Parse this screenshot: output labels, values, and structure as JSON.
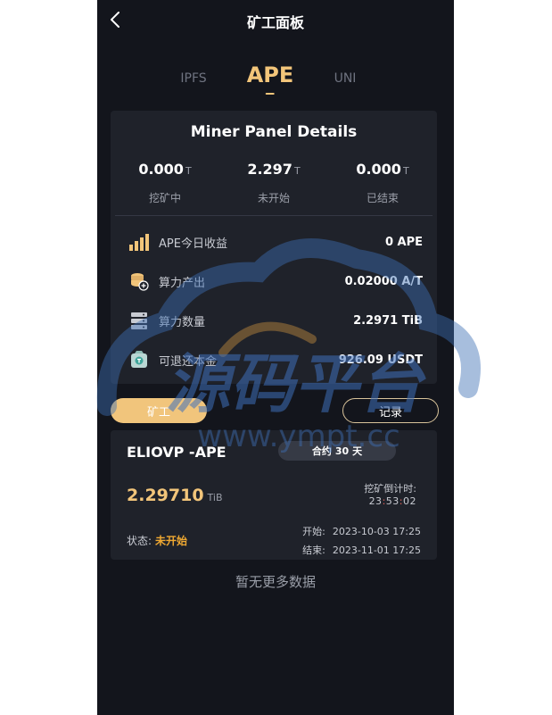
{
  "header": {
    "title": "矿工面板"
  },
  "tabs": [
    {
      "label": "IPFS",
      "active": false
    },
    {
      "label": "APE",
      "active": true
    },
    {
      "label": "UNI",
      "active": false
    }
  ],
  "details": {
    "title": "Miner Panel Details",
    "stats": [
      {
        "value": "0.000",
        "unit": "T",
        "label": "挖矿中"
      },
      {
        "value": "2.297",
        "unit": "T",
        "label": "未开始"
      },
      {
        "value": "0.000",
        "unit": "T",
        "label": "已结束"
      }
    ],
    "rows": [
      {
        "icon": "bar-chart-icon",
        "label": "APE今日收益",
        "value": "0 APE"
      },
      {
        "icon": "coin-stack-add-icon",
        "label": "算力产出",
        "value": "0.02000 A/T"
      },
      {
        "icon": "server-icon",
        "label": "算力数量",
        "value": "2.2971 TiB"
      },
      {
        "icon": "wallet-icon",
        "label": "可退还本金",
        "value": "926.09 USDT"
      }
    ]
  },
  "buttons": {
    "mine": "矿工",
    "record": "记录"
  },
  "order": {
    "name": "ELIOVP -APE",
    "contract_prefix": "合约",
    "contract_days": "30",
    "contract_suffix": "天",
    "power_value": "2.29710",
    "power_unit": "TiB",
    "countdown_label": "挖矿倒计时:",
    "countdown_h": "23",
    "countdown_m": "53",
    "countdown_s": "02",
    "status_label": "状态:",
    "status_value": "未开始",
    "start_label": "开始:",
    "start_time": "2023-10-03 17:25",
    "end_label": "结束:",
    "end_time": "2023-11-01 17:25"
  },
  "footer": {
    "no_more": "暂无更多数据"
  },
  "watermark": {
    "text_cn": "源码平台",
    "text_url": "www.ympt.cc"
  },
  "colors": {
    "accent": "#f2c57a",
    "status_pending": "#f0a932",
    "background": "#13151c",
    "card": "#1f222a"
  }
}
